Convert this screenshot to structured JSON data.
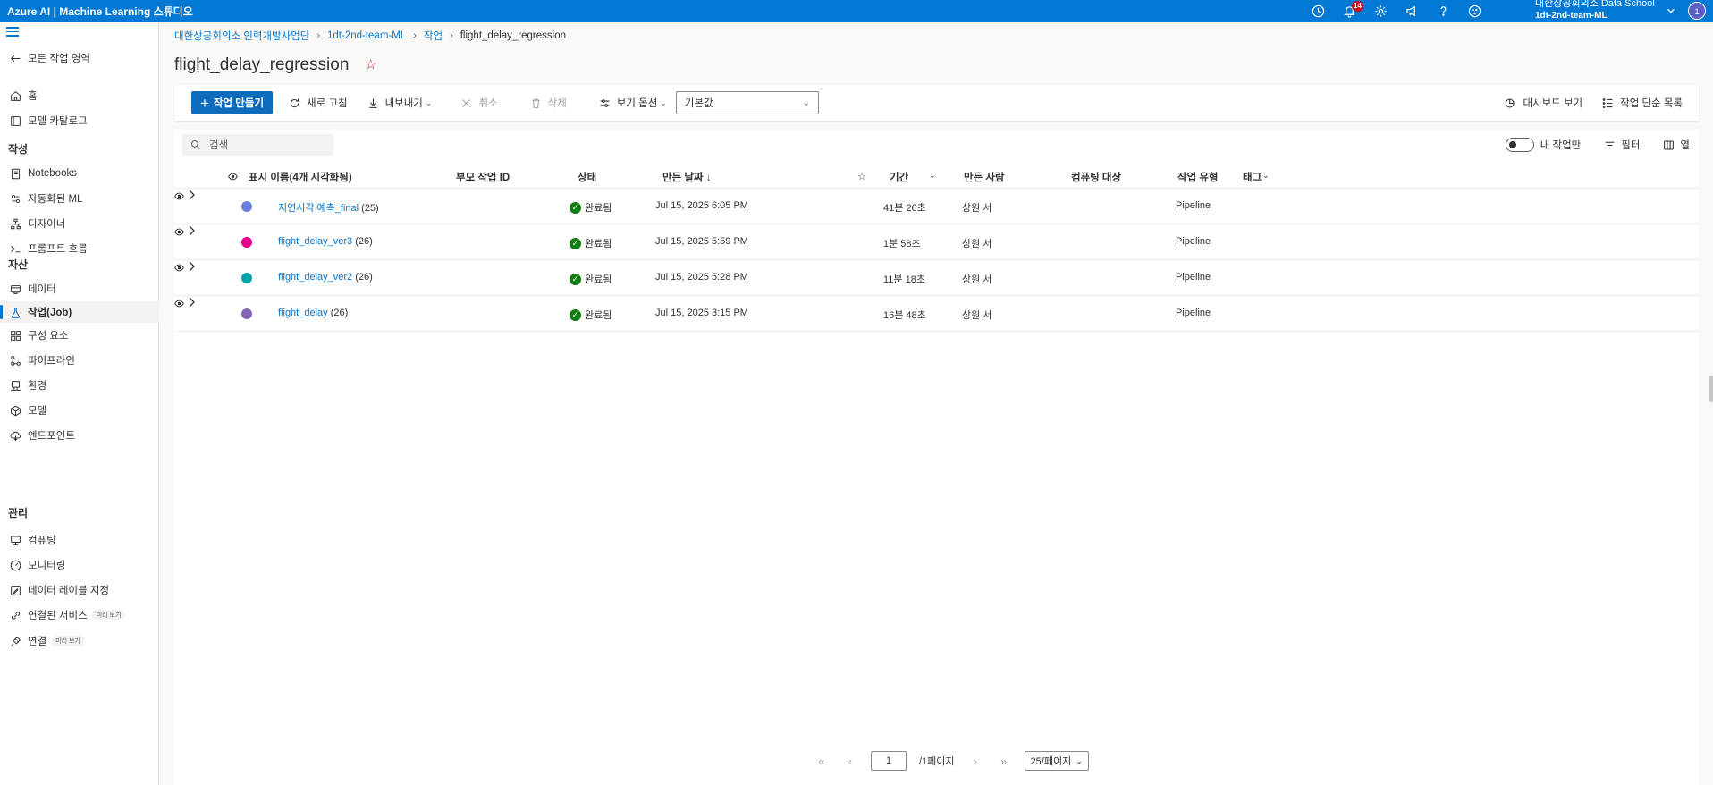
{
  "topbar": {
    "title": "Azure AI | Machine Learning 스튜디오",
    "notification_count": "14",
    "org_name": "대한상공회의소 Data School",
    "workspace_name": "1dt-2nd-team-ML",
    "avatar_initial": "1"
  },
  "sidebar": {
    "back_label": "모든 작업 영역",
    "items_top": [
      {
        "label": "홈",
        "icon": "home-icon"
      },
      {
        "label": "모델 카탈로그",
        "icon": "catalog-icon"
      }
    ],
    "section_author": "작성",
    "items_author": [
      {
        "label": "Notebooks",
        "icon": "notebook-icon"
      },
      {
        "label": "자동화된 ML",
        "icon": "automl-icon"
      },
      {
        "label": "디자이너",
        "icon": "designer-icon"
      },
      {
        "label": "프롬프트 흐름",
        "icon": "prompt-flow-icon"
      }
    ],
    "section_assets": "자산",
    "items_assets": [
      {
        "label": "데이터",
        "icon": "data-icon"
      },
      {
        "label": "작업(Job)",
        "icon": "flask-icon",
        "active": true
      },
      {
        "label": "구성 요소",
        "icon": "component-icon"
      },
      {
        "label": "파이프라인",
        "icon": "pipeline-icon"
      },
      {
        "label": "환경",
        "icon": "environment-icon"
      },
      {
        "label": "모델",
        "icon": "model-icon"
      },
      {
        "label": "엔드포인트",
        "icon": "endpoint-icon"
      }
    ],
    "section_manage": "관리",
    "items_manage": [
      {
        "label": "컴퓨팅",
        "icon": "compute-icon"
      },
      {
        "label": "모니터링",
        "icon": "monitor-icon"
      },
      {
        "label": "데이터 레이블 지정",
        "icon": "label-icon"
      },
      {
        "label": "연결된 서비스",
        "icon": "linked-service-icon",
        "tag": "미리 보기"
      },
      {
        "label": "연결",
        "icon": "connection-icon",
        "tag": "미리 보기"
      }
    ]
  },
  "breadcrumb": [
    "대한상공회의소 인력개발사업단",
    "1dt-2nd-team-ML",
    "작업",
    "flight_delay_regression"
  ],
  "page_title": "flight_delay_regression",
  "toolbar": {
    "create_job": "작업 만들기",
    "refresh": "새로 고침",
    "export": "내보내기",
    "cancel": "취소",
    "delete": "삭제",
    "view_options": "보기 옵션",
    "view_select": "기본값",
    "dashboard_view": "대시보드 보기",
    "simple_list": "작업 단순 목록"
  },
  "filters": {
    "search_placeholder": "검색",
    "my_jobs_only": "내 작업만",
    "filter": "필터",
    "columns": "열"
  },
  "grid": {
    "headers": {
      "display_name": "표시 이름(4개 시각화됨)",
      "parent_job": "부모 작업 ID",
      "status": "상태",
      "created": "만든 날짜 ↓",
      "duration": "기간",
      "created_by": "만든 사람",
      "compute": "컴퓨팅 대상",
      "job_type": "작업 유형",
      "tags": "태그"
    },
    "rows": [
      {
        "name": "지연시각 예측_final",
        "count": "(25)",
        "color": "#6b7fe0",
        "status": "완료됨",
        "created": "Jul 15, 2025 6:05 PM",
        "duration": "41분 26초",
        "created_by": "상원 서",
        "job_type": "Pipeline"
      },
      {
        "name": "flight_delay_ver3",
        "count": "(26)",
        "color": "#e3008c",
        "status": "완료됨",
        "created": "Jul 15, 2025 5:59 PM",
        "duration": "1분 58초",
        "created_by": "상원 서",
        "job_type": "Pipeline"
      },
      {
        "name": "flight_delay_ver2",
        "count": "(26)",
        "color": "#00a5a8",
        "status": "완료됨",
        "created": "Jul 15, 2025 5:28 PM",
        "duration": "11분 18초",
        "created_by": "상원 서",
        "job_type": "Pipeline"
      },
      {
        "name": "flight_delay",
        "count": "(26)",
        "color": "#8764b8",
        "status": "완료됨",
        "created": "Jul 15, 2025 3:15 PM",
        "duration": "16분 48초",
        "created_by": "상원 서",
        "job_type": "Pipeline"
      }
    ]
  },
  "pager": {
    "current_page": "1",
    "total_pages": "/1페이지",
    "page_size": "25/페이지"
  }
}
